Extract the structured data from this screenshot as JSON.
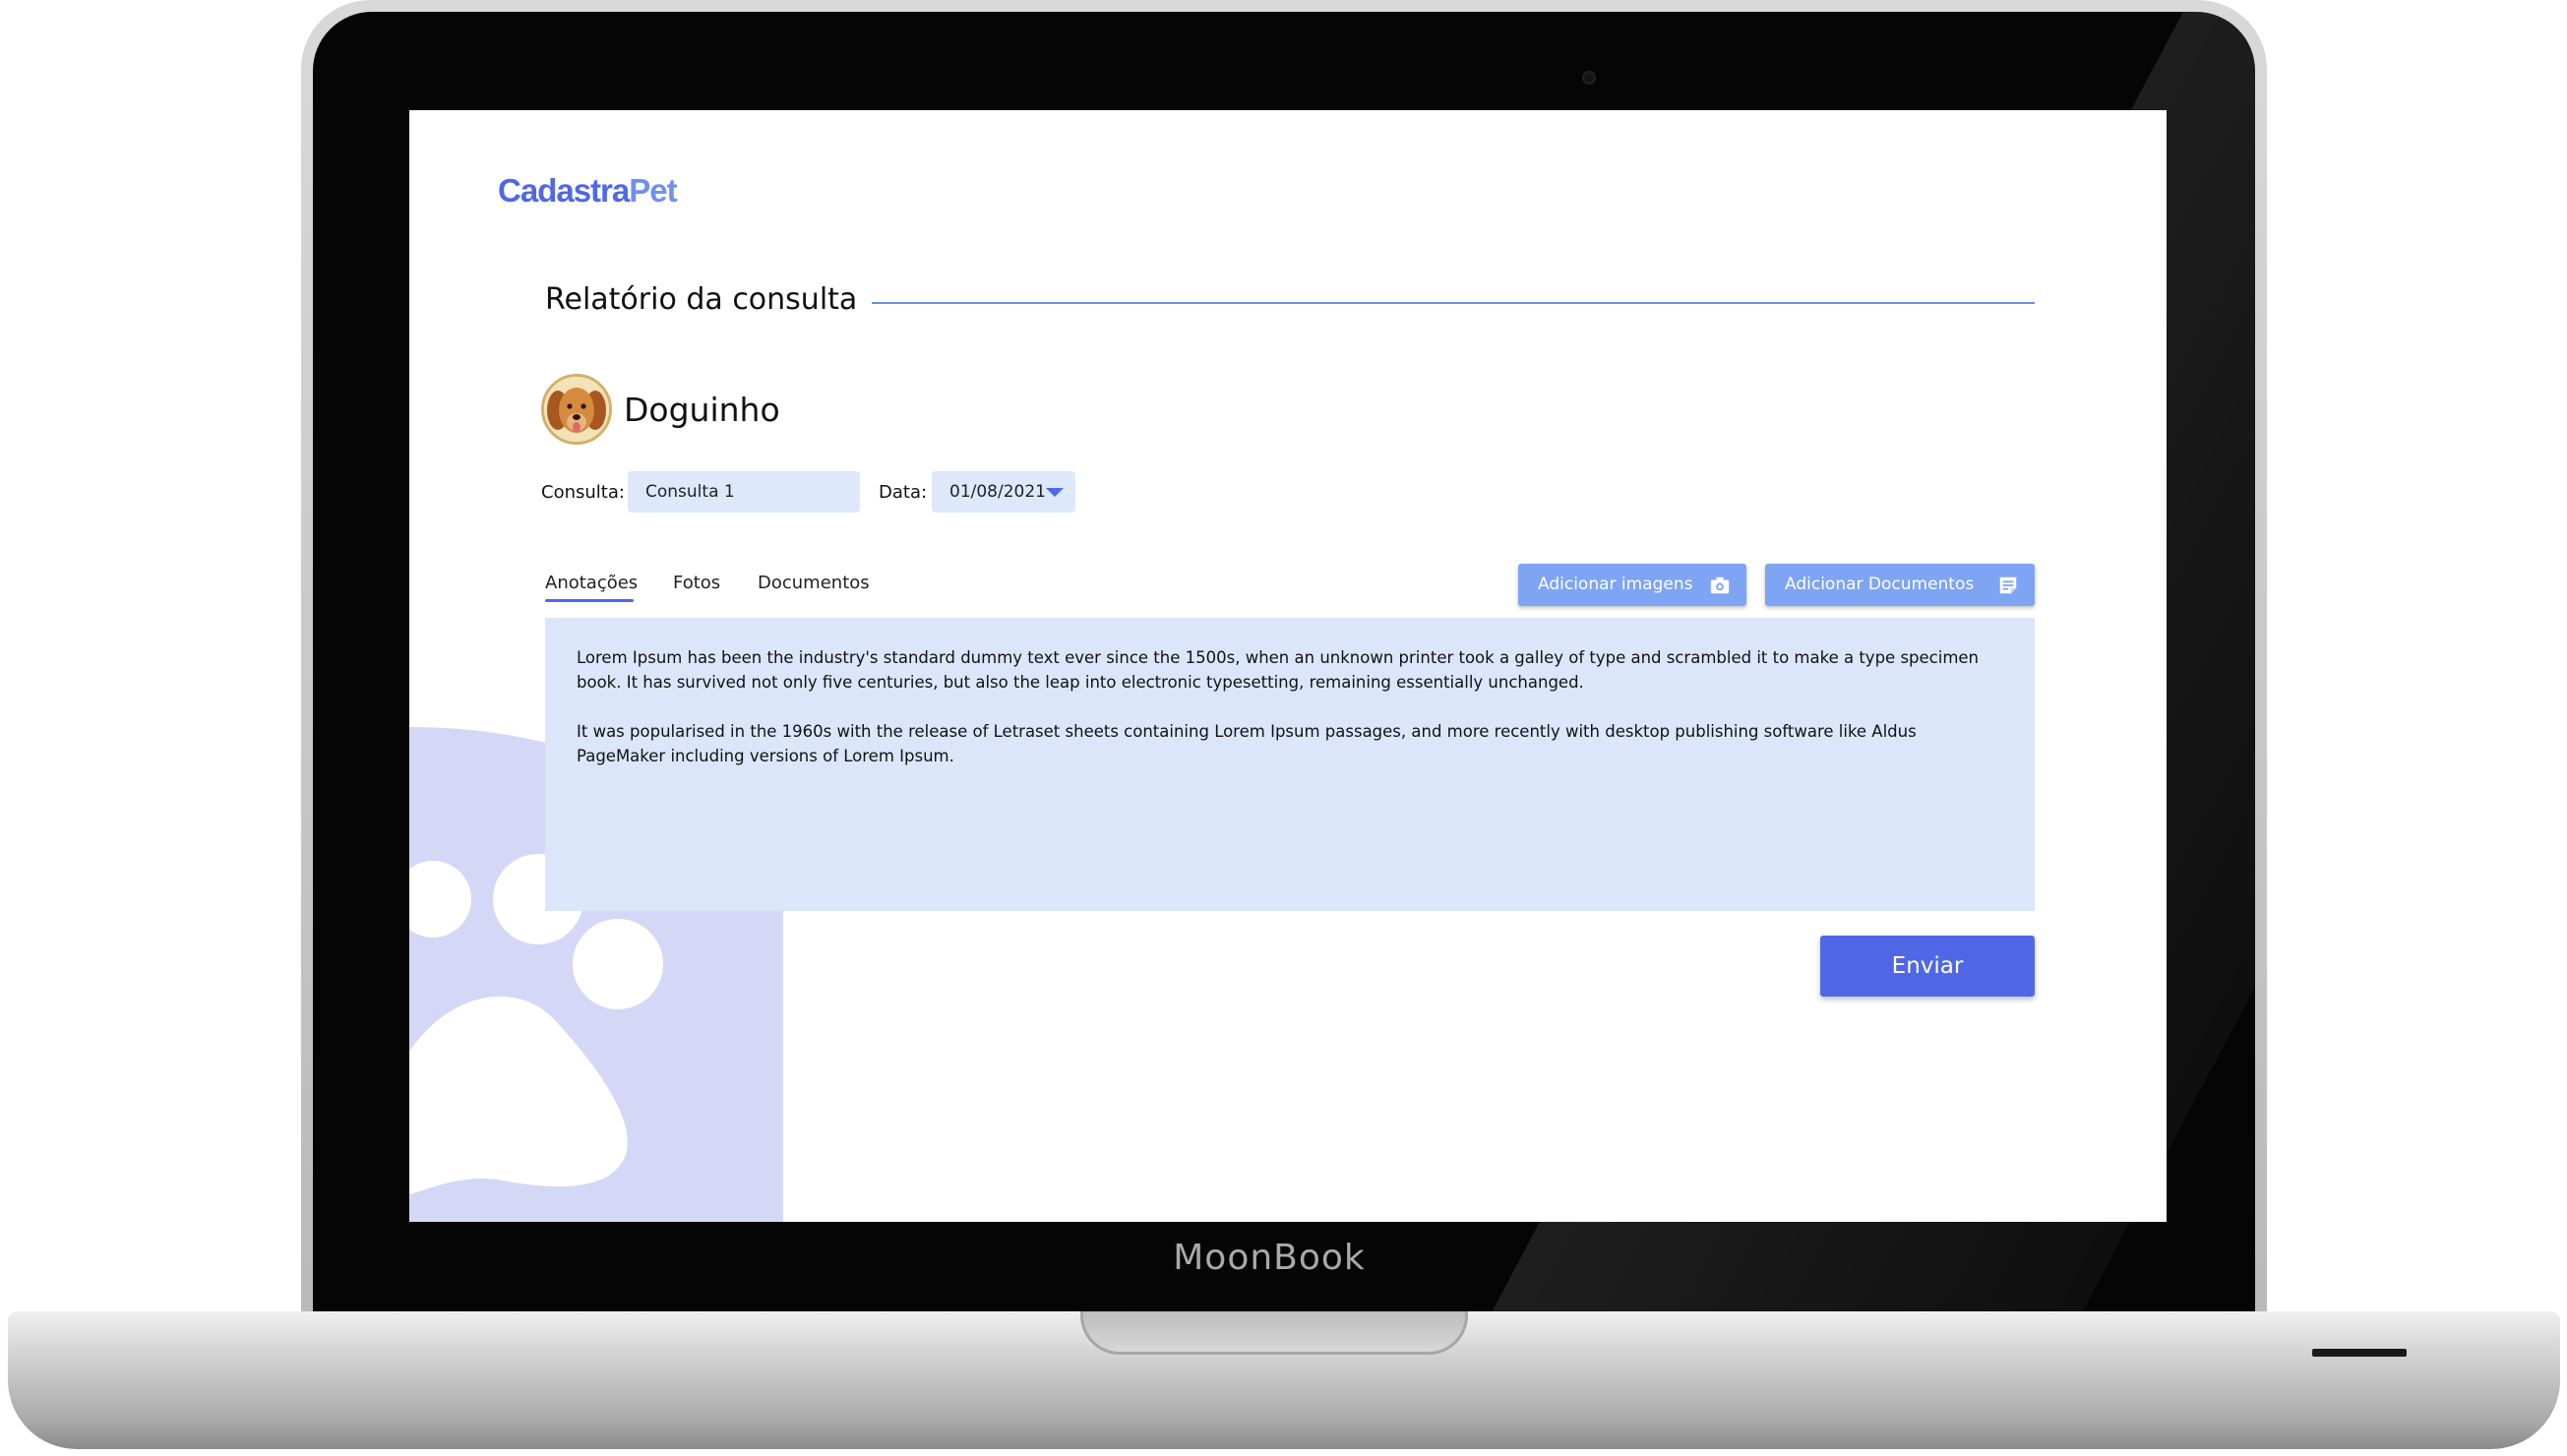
{
  "device": {
    "brand_label": "MoonBook"
  },
  "app": {
    "logo_part1": "Cadastra",
    "logo_part2": "Pet",
    "page_title": "Relatório da consulta"
  },
  "pet": {
    "name": "Doguinho",
    "avatar": "dog-photo"
  },
  "form": {
    "consulta_label": "Consulta:",
    "consulta_value": "Consulta 1",
    "data_label": "Data:",
    "data_value": "01/08/2021"
  },
  "tabs": [
    {
      "label": "Anotações",
      "active": true
    },
    {
      "label": "Fotos",
      "active": false
    },
    {
      "label": "Documentos",
      "active": false
    }
  ],
  "actions": {
    "add_images_label": "Adicionar imagens",
    "add_images_icon": "camera-icon",
    "add_documents_label": "Adicionar Documentos",
    "add_documents_icon": "document-icon",
    "submit_label": "Enviar"
  },
  "notes": {
    "paragraph_1": "Lorem Ipsum has been the industry's standard dummy text ever since the 1500s, when an unknown printer took a galley of type and scrambled it to make a type specimen book. It has survived not only five centuries, but also the leap into electronic typesetting, remaining essentially unchanged.",
    "paragraph_2": "It was popularised in the 1960s with the release of Letraset sheets containing Lorem Ipsum passages, and more recently with desktop publishing software like Aldus PageMaker including versions of Lorem Ipsum."
  },
  "colors": {
    "primary": "#5067e5",
    "secondary_button": "#7ea4f4",
    "field_background": "#dde8fb",
    "paw_background": "#d4d8f6"
  }
}
